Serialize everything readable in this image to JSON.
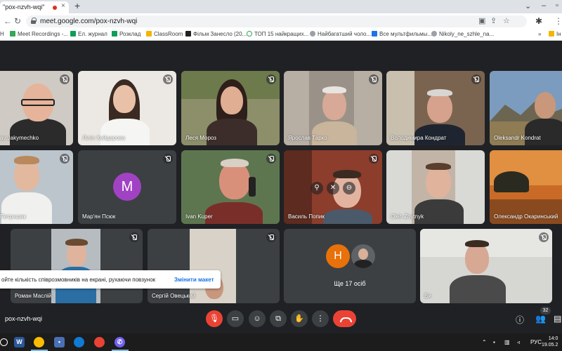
{
  "browser": {
    "tab_title": "\"pox-nzvh-wqi\"",
    "tab_close": "×",
    "new_tab": "+",
    "url": "meet.google.com/pox-nzvh-wqi"
  },
  "bookmarks": [
    {
      "label": "H",
      "color": "#f4b400"
    },
    {
      "label": "Meet Recordings -...",
      "color": "#34a853"
    },
    {
      "label": "Ел. журнал",
      "color": "#0f9d58"
    },
    {
      "label": "Розклад",
      "color": "#0f9d58"
    },
    {
      "label": "ClassRoom",
      "color": "#f4b400"
    },
    {
      "label": "Фільм Занесло (20...",
      "color": "#202124"
    },
    {
      "label": "ТОП 15 найкращих...",
      "color": "#34a853"
    },
    {
      "label": "Найбагатший чоло...",
      "color": "#5f6368"
    },
    {
      "label": "Все мультфильмы...",
      "color": "#1a73e8"
    },
    {
      "label": "Nikoly_ne_szhle_na...",
      "color": "#5f6368"
    },
    {
      "label": "Ін",
      "color": "#f4b400"
    }
  ],
  "participants": [
    {
      "name": "av Jakymechko"
    },
    {
      "name": "Лілія Хайдарова"
    },
    {
      "name": "Леся Мороз"
    },
    {
      "name": "Ярослав Тарко"
    },
    {
      "name": "Володимира Кондрат"
    },
    {
      "name": "Oleksandr Kondrat"
    },
    {
      "name": "Петришак"
    },
    {
      "name": "Мар'ян Псюк",
      "initial": "M",
      "color": "#a142c4"
    },
    {
      "name": "Ivan Kuper"
    },
    {
      "name": "Василь Попик"
    },
    {
      "name": "Oleh Zhytnyk"
    },
    {
      "name": "Олександр Окаринський"
    },
    {
      "name": "Роман Маслій"
    },
    {
      "name": "Сергій Овецький"
    },
    {
      "name": "Ви"
    }
  ],
  "more_tile": {
    "label": "Ще 17 осіб",
    "initial": "Н",
    "color": "#e8710a"
  },
  "toast": {
    "text": "ойте кількість співрозмовників на екрані, рухаючи повзунок",
    "action": "Змінити макет"
  },
  "controls": {
    "meeting_code": "pox-nzvh-wqi",
    "people_count": "32"
  },
  "taskbar": {
    "lang": "РУС",
    "time": "14:0",
    "date": "19.05.2"
  },
  "colors": {
    "meet_bg": "#202124",
    "tile_bg": "#3c4043",
    "end_call": "#ea4335",
    "accent": "#1a73e8"
  }
}
